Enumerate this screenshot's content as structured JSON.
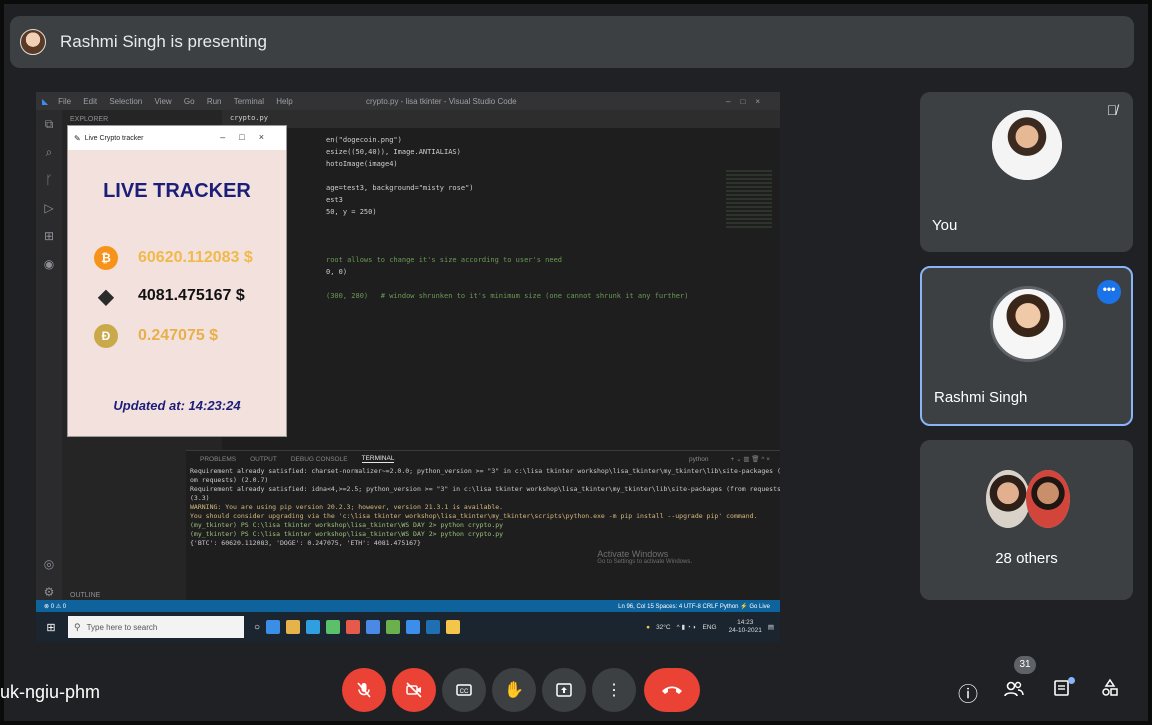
{
  "banner": {
    "presenting_text": "Rashmi Singh is presenting"
  },
  "shared_screen": {
    "vscode": {
      "menu": [
        "File",
        "Edit",
        "Selection",
        "View",
        "Go",
        "Run",
        "Terminal",
        "Help"
      ],
      "window_title": "crypto.py - lisa tkinter - Visual Studio Code",
      "explorer_header": "EXPLORER",
      "outline_label": "OUTLINE",
      "open_tab": "crypto.py",
      "code_lines": [
        "en(\"dogecoin.png\")",
        "esize((50,40)), Image.ANTIALIAS)",
        "hotoImage(image4)",
        "",
        "age=test3, background=\"misty rose\")",
        "est3",
        "50, y = 250)",
        "",
        "",
        "",
        "root allows to change it's size according to user's need",
        "0, 0)",
        "",
        "(300, 280)   # window shrunken to it's minimum size (one cannot shrunk it any further)"
      ],
      "panel_tabs": [
        "PROBLEMS",
        "OUTPUT",
        "DEBUG CONSOLE",
        "TERMINAL"
      ],
      "panel_shell": "python",
      "terminal_lines": [
        "Requirement already satisfied: charset-normalizer~=2.0.0; python_version >= \"3\" in c:\\lisa tkinter workshop\\lisa_tkinter\\my_tkinter\\lib\\site-packages (fr",
        "om requests) (2.0.7)",
        "Requirement already satisfied: idna<4,>=2.5; python_version >= \"3\" in c:\\lisa tkinter workshop\\lisa_tkinter\\my_tkinter\\lib\\site-packages (from requests)",
        "(3.3)",
        "WARNING: You are using pip version 20.2.3; however, version 21.3.1 is available.",
        "You should consider upgrading via the 'c:\\lisa tkinter workshop\\lisa_tkinter\\my_tkinter\\scripts\\python.exe -m pip install --upgrade pip' command.",
        "(my_tkinter) PS C:\\lisa tkinter workshop\\lisa_tkinter\\WS DAY 2> python crypto.py",
        "(my_tkinter) PS C:\\lisa tkinter workshop\\lisa_tkinter\\WS DAY 2> python crypto.py",
        "{'BTC': 60620.112083, 'DOGE': 0.247075, 'ETH': 4081.475167}"
      ],
      "watermark_title": "Activate Windows",
      "watermark_sub": "Go to Settings to activate Windows.",
      "status_left": "⊗ 0 ⚠ 0",
      "status_right": "Ln 96, Col 15   Spaces: 4   UTF-8   CRLF   Python   ⚡ Go Live"
    },
    "taskbar": {
      "search_placeholder": "Type here to search",
      "weather": "32°C",
      "lang": "ENG",
      "time": "14:23",
      "date": "24-10-2021"
    },
    "tracker": {
      "window_title": "Live Crypto tracker",
      "title": "LIVE TRACKER",
      "coins": [
        {
          "icon": "bitcoin-icon",
          "symbol": "₿",
          "value": "60620.112083 $",
          "color": "#f7931a",
          "value_color": "#f0b94a"
        },
        {
          "icon": "ethereum-icon",
          "symbol": "◆",
          "value": "4081.475167 $",
          "color": "#2b2b2b",
          "value_color": "#111111"
        },
        {
          "icon": "dogecoin-icon",
          "symbol": "Ð",
          "value": "0.247075 $",
          "color": "#c9a94a",
          "value_color": "#e8b04a"
        }
      ],
      "updated": "Updated at: 14:23:24"
    }
  },
  "participants": {
    "you": {
      "name": "You",
      "muted": true
    },
    "rashmi": {
      "name": "Rashmi Singh",
      "more": "•••"
    },
    "others": {
      "label": "28 others"
    }
  },
  "bottom_bar": {
    "meeting_code": "uk-ngiu-phm",
    "people_count": "31",
    "controls": [
      "mic-off",
      "camera-off",
      "captions",
      "raise-hand",
      "present",
      "more",
      "leave"
    ]
  },
  "colors": {
    "accent": "#1a73e8",
    "danger": "#ea4335",
    "tile_bg": "#3c4043",
    "bg": "#202124"
  }
}
